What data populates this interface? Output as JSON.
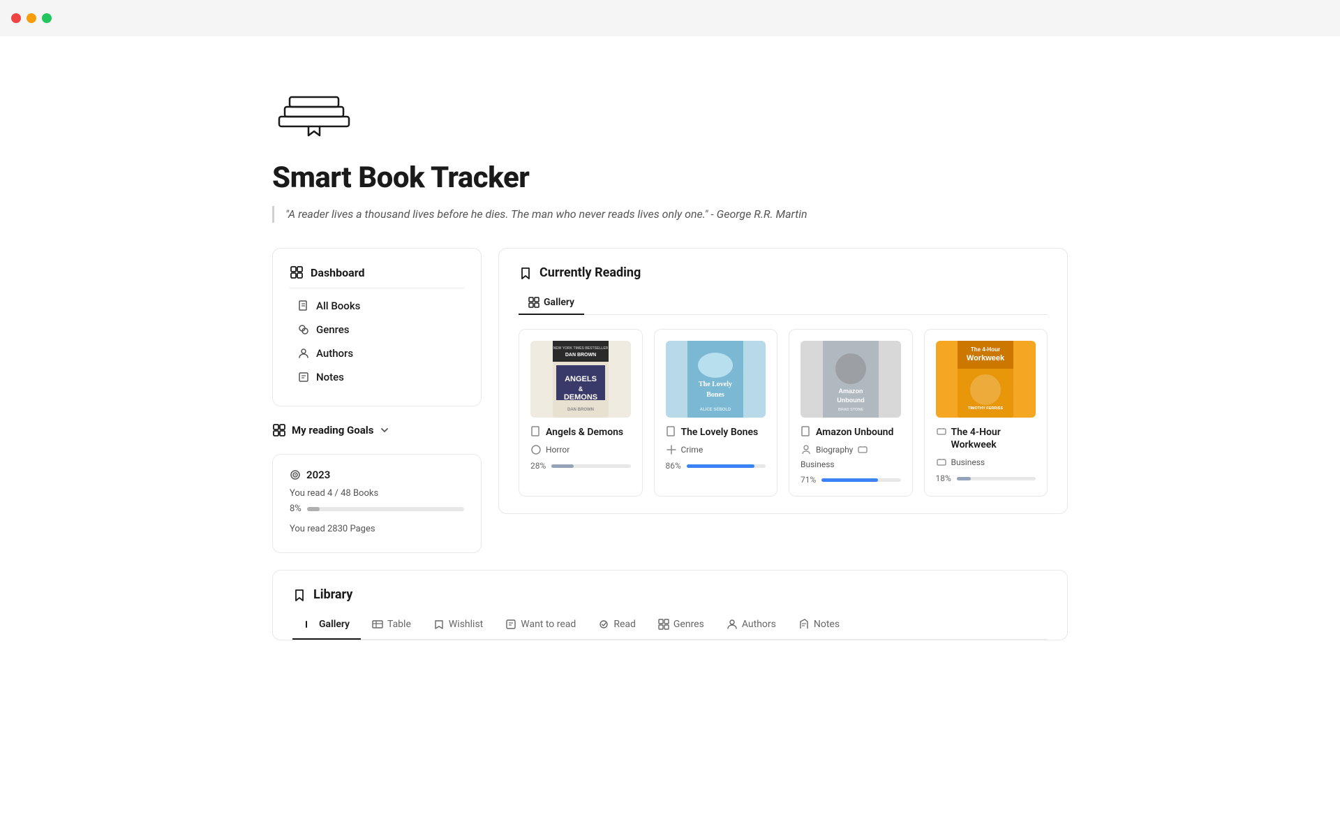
{
  "titlebar": {
    "btn_red": "#ef4444",
    "btn_yellow": "#f59e0b",
    "btn_green": "#22c55e"
  },
  "page": {
    "title": "Smart Book Tracker",
    "quote": "\"A reader lives a thousand lives before he dies. The man who never reads lives only one.\" - George R.R. Martin"
  },
  "sidebar": {
    "nav_title": "Dashboard",
    "nav_items": [
      {
        "label": "All Books"
      },
      {
        "label": "Genres"
      },
      {
        "label": "Authors"
      },
      {
        "label": "Notes"
      }
    ],
    "goals_label": "My reading Goals",
    "year": "2023",
    "stat1": "You read 4 / 48 Books",
    "stat2": "8%",
    "progress1": 8,
    "stat3": "You read 2830 Pages"
  },
  "currently_reading": {
    "section_title": "Currently Reading",
    "tabs": [
      {
        "label": "Gallery",
        "active": true
      }
    ],
    "books": [
      {
        "title": "Angels & Demons",
        "genres": [
          "Horror"
        ],
        "progress": 28,
        "cover_bg": "#f4f0e8",
        "cover_text": "DAN BROWN\nANGELS &\nDEMONS"
      },
      {
        "title": "The Lovely Bones",
        "genres": [
          "Crime"
        ],
        "progress": 86,
        "cover_bg": "#b8dae8",
        "cover_text": "THE\nLOVELY\nBONES"
      },
      {
        "title": "Amazon Unbound",
        "genres": [
          "Biography",
          "Business"
        ],
        "progress": 71,
        "cover_bg": "#d0d8e0",
        "cover_text": "Amazon\nUnbound"
      },
      {
        "title": "The 4-Hour Workweek",
        "genres": [
          "Business"
        ],
        "progress": 18,
        "cover_bg": "#f5a623",
        "cover_text": "The 4-Hour\nWorkweek\nTIMOTHY FERRISS"
      }
    ]
  },
  "library": {
    "section_title": "Library",
    "tabs": [
      {
        "label": "Gallery",
        "active": true
      },
      {
        "label": "Table"
      },
      {
        "label": "Wishlist"
      },
      {
        "label": "Want to read"
      },
      {
        "label": "Read"
      },
      {
        "label": "Genres"
      },
      {
        "label": "Authors"
      },
      {
        "label": "Notes"
      }
    ]
  }
}
